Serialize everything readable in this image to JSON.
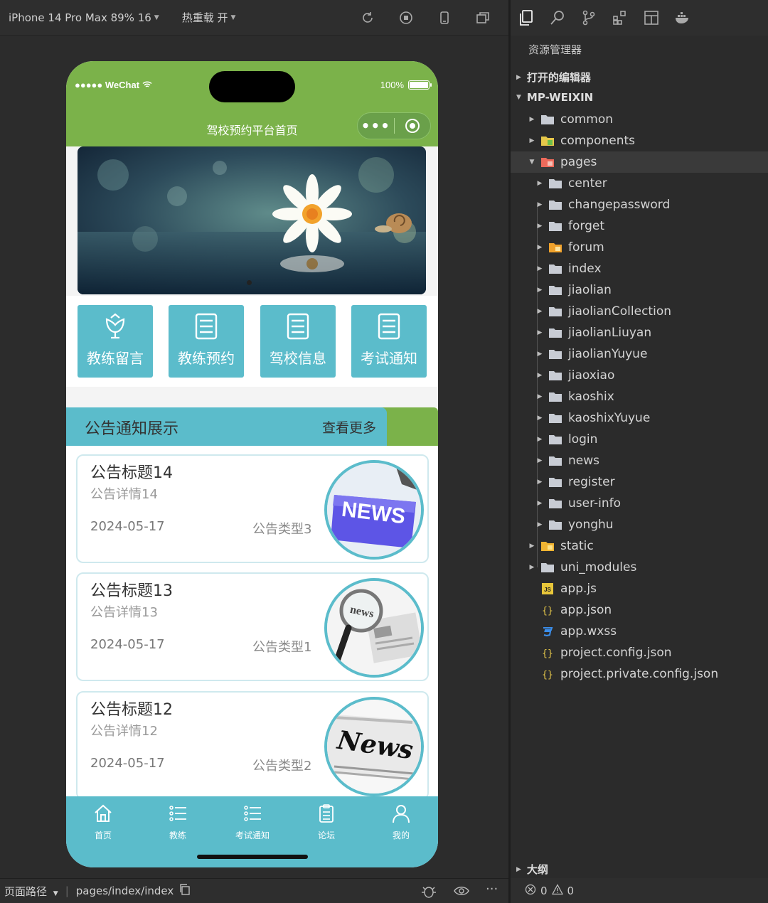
{
  "simulator": {
    "device_label": "iPhone 14 Pro Max 89% 16",
    "hot_reload_label": "热重载 开"
  },
  "phone": {
    "status_carrier": "●●●●● WeChat",
    "status_battery": "100%",
    "nav_title": "驾校预约平台首页",
    "capsule_dots": "•••",
    "menu": [
      {
        "label": "教练留言",
        "icon": "flower-icon"
      },
      {
        "label": "教练预约",
        "icon": "document-icon"
      },
      {
        "label": "驾校信息",
        "icon": "document-icon"
      },
      {
        "label": "考试通知",
        "icon": "document-icon"
      }
    ],
    "notice_header": {
      "title": "公告通知展示",
      "more": "查看更多"
    },
    "notices": [
      {
        "title": "公告标题14",
        "detail": "公告详情14",
        "date": "2024-05-17",
        "type": "公告类型3",
        "image": "news-key-image"
      },
      {
        "title": "公告标题13",
        "detail": "公告详情13",
        "date": "2024-05-17",
        "type": "公告类型1",
        "image": "news-magnifier-image"
      },
      {
        "title": "公告标题12",
        "detail": "公告详情12",
        "date": "2024-05-17",
        "type": "公告类型2",
        "image": "news-newspaper-image"
      }
    ],
    "notice_image_text": {
      "key": "NEWS",
      "magnifier": "news",
      "paper": "News"
    },
    "tabbar": [
      {
        "label": "首页",
        "icon": "home-icon"
      },
      {
        "label": "教练",
        "icon": "list-icon"
      },
      {
        "label": "考试通知",
        "icon": "list-icon"
      },
      {
        "label": "论坛",
        "icon": "clipboard-icon"
      },
      {
        "label": "我的",
        "icon": "user-icon"
      }
    ]
  },
  "bottom_bar": {
    "page_path_label": "页面路径",
    "page_path": "pages/index/index"
  },
  "explorer": {
    "title": "资源管理器",
    "open_editors": "打开的编辑器",
    "project": "MP-WEIXIN",
    "tree": [
      {
        "name": "common",
        "depth": 1,
        "kind": "folder",
        "expanded": false
      },
      {
        "name": "components",
        "depth": 1,
        "kind": "folder-components",
        "expanded": false
      },
      {
        "name": "pages",
        "depth": 1,
        "kind": "folder-pages",
        "expanded": true
      },
      {
        "name": "center",
        "depth": 2,
        "kind": "folder",
        "expanded": false
      },
      {
        "name": "changepassword",
        "depth": 2,
        "kind": "folder",
        "expanded": false
      },
      {
        "name": "forget",
        "depth": 2,
        "kind": "folder",
        "expanded": false
      },
      {
        "name": "forum",
        "depth": 2,
        "kind": "folder-forum",
        "expanded": false
      },
      {
        "name": "index",
        "depth": 2,
        "kind": "folder",
        "expanded": false
      },
      {
        "name": "jiaolian",
        "depth": 2,
        "kind": "folder",
        "expanded": false
      },
      {
        "name": "jiaolianCollection",
        "depth": 2,
        "kind": "folder",
        "expanded": false
      },
      {
        "name": "jiaolianLiuyan",
        "depth": 2,
        "kind": "folder",
        "expanded": false
      },
      {
        "name": "jiaolianYuyue",
        "depth": 2,
        "kind": "folder",
        "expanded": false
      },
      {
        "name": "jiaoxiao",
        "depth": 2,
        "kind": "folder",
        "expanded": false
      },
      {
        "name": "kaoshix",
        "depth": 2,
        "kind": "folder",
        "expanded": false
      },
      {
        "name": "kaoshixYuyue",
        "depth": 2,
        "kind": "folder",
        "expanded": false
      },
      {
        "name": "login",
        "depth": 2,
        "kind": "folder",
        "expanded": false
      },
      {
        "name": "news",
        "depth": 2,
        "kind": "folder",
        "expanded": false
      },
      {
        "name": "register",
        "depth": 2,
        "kind": "folder",
        "expanded": false
      },
      {
        "name": "user-info",
        "depth": 2,
        "kind": "folder",
        "expanded": false
      },
      {
        "name": "yonghu",
        "depth": 2,
        "kind": "folder",
        "expanded": false
      },
      {
        "name": "static",
        "depth": 1,
        "kind": "folder-static",
        "expanded": false
      },
      {
        "name": "uni_modules",
        "depth": 1,
        "kind": "folder",
        "expanded": false
      },
      {
        "name": "app.js",
        "depth": 1,
        "kind": "js-file"
      },
      {
        "name": "app.json",
        "depth": 1,
        "kind": "json-file"
      },
      {
        "name": "app.wxss",
        "depth": 1,
        "kind": "css-file"
      },
      {
        "name": "project.config.json",
        "depth": 1,
        "kind": "json-file"
      },
      {
        "name": "project.private.config.json",
        "depth": 1,
        "kind": "json-file"
      }
    ],
    "outline": "大纲",
    "errors": "0",
    "warnings": "0"
  },
  "colors": {
    "header_green": "#7bb24a",
    "accent_teal": "#5bbccb",
    "editor_bg": "#2b2b2b"
  }
}
